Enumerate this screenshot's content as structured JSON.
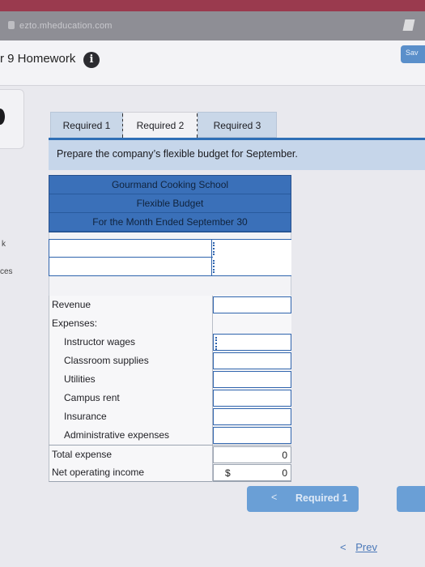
{
  "browser": {
    "url": "ezto.mheducation.com"
  },
  "header": {
    "title": "r 9 Homework",
    "save_label": "Sav"
  },
  "sidebar": {
    "stub_1": "k",
    "stub_2": "ces"
  },
  "tabs": [
    {
      "label": "Required 1"
    },
    {
      "label": "Required 2"
    },
    {
      "label": "Required 3"
    }
  ],
  "prompt": "Prepare the company’s flexible budget for September.",
  "budget": {
    "company": "Gourmand Cooking School",
    "title": "Flexible Budget",
    "period": "For the Month Ended September 30",
    "revenue_label": "Revenue",
    "expenses_label": "Expenses:",
    "expense_items": [
      "Instructor wages",
      "Classroom supplies",
      "Utilities",
      "Campus rent",
      "Insurance",
      "Administrative expenses"
    ],
    "total_label": "Total expense",
    "total_value": "0",
    "net_label": "Net operating income",
    "net_currency": "$",
    "net_value": "0"
  },
  "nav": {
    "prev_required_label": "Required 1",
    "prev_required_chevron": "<",
    "prev_link_label": "Prev",
    "prev_link_chevron": "<"
  },
  "colors": {
    "accent": "#2f64ad",
    "prompt_bg": "#c6d6ea",
    "button": "#6a9fd6"
  }
}
